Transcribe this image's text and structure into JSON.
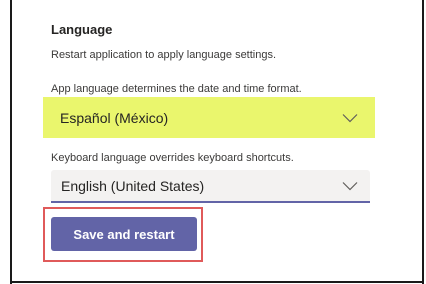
{
  "section": {
    "title": "Language",
    "restart_note": "Restart application to apply language settings.",
    "app_language_note": "App language determines the date and time format.",
    "keyboard_language_note": "Keyboard language overrides keyboard shortcuts."
  },
  "app_language": {
    "selected": "Español (México)",
    "icon": "chevron-down-icon",
    "highlight_color": "#eaf66d"
  },
  "keyboard_language": {
    "selected": "English (United States)",
    "icon": "chevron-down-icon",
    "underline_color": "#6264a7"
  },
  "actions": {
    "save_label": "Save and restart",
    "button_color": "#6264a7",
    "outline_color": "#e05a5a"
  }
}
